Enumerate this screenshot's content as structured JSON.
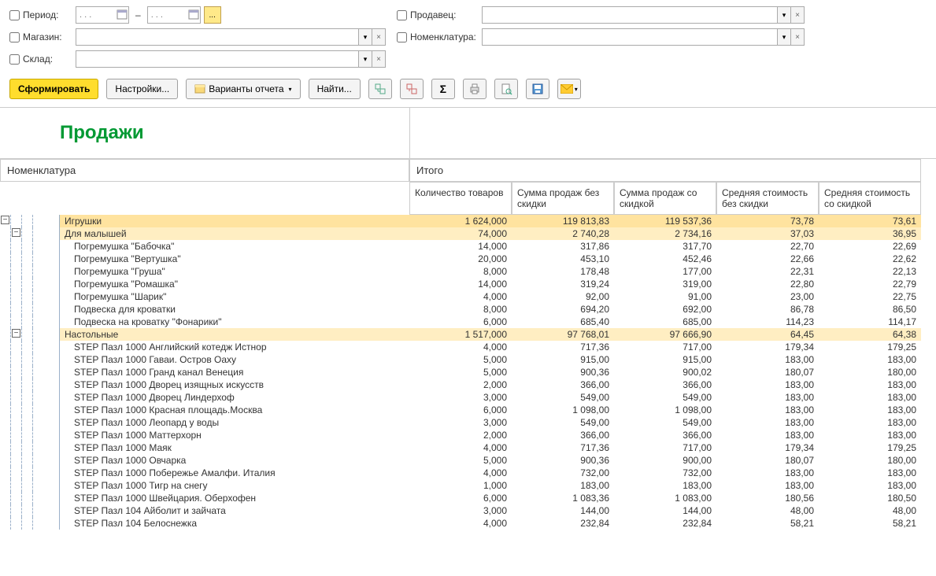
{
  "filters": {
    "period_label": "Период:",
    "date_placeholder": ". . .",
    "magazin_label": "Магазин:",
    "sklad_label": "Склад:",
    "prodavec_label": "Продавец:",
    "nomen_label": "Номенклатура:"
  },
  "toolbar": {
    "form": "Сформировать",
    "settings": "Настройки...",
    "variants": "Варианты отчета",
    "find": "Найти..."
  },
  "report": {
    "title": "Продажи",
    "header": {
      "nomen": "Номенклатура",
      "itogo": "Итого",
      "cols": [
        "Количество товаров",
        "Сумма продаж без скидки",
        "Сумма продаж со скидкой",
        "Средняя стоимость без скидки",
        "Средняя стоимость со скидкой"
      ]
    },
    "rows": [
      {
        "level": 1,
        "name": "Игрушки",
        "v": [
          "1 624,000",
          "119 813,83",
          "119 537,36",
          "73,78",
          "73,61"
        ]
      },
      {
        "level": 2,
        "name": "Для малышей",
        "v": [
          "74,000",
          "2 740,28",
          "2 734,16",
          "37,03",
          "36,95"
        ]
      },
      {
        "level": 3,
        "name": "Погремушка \"Бабочка\"",
        "v": [
          "14,000",
          "317,86",
          "317,70",
          "22,70",
          "22,69"
        ]
      },
      {
        "level": 3,
        "name": "Погремушка \"Вертушка\"",
        "v": [
          "20,000",
          "453,10",
          "452,46",
          "22,66",
          "22,62"
        ]
      },
      {
        "level": 3,
        "name": "Погремушка \"Груша\"",
        "v": [
          "8,000",
          "178,48",
          "177,00",
          "22,31",
          "22,13"
        ]
      },
      {
        "level": 3,
        "name": "Погремушка \"Ромашка\"",
        "v": [
          "14,000",
          "319,24",
          "319,00",
          "22,80",
          "22,79"
        ]
      },
      {
        "level": 3,
        "name": "Погремушка \"Шарик\"",
        "v": [
          "4,000",
          "92,00",
          "91,00",
          "23,00",
          "22,75"
        ]
      },
      {
        "level": 3,
        "name": "Подвеска для кроватки",
        "v": [
          "8,000",
          "694,20",
          "692,00",
          "86,78",
          "86,50"
        ]
      },
      {
        "level": 3,
        "name": "Подвеска на кроватку \"Фонарики\"",
        "v": [
          "6,000",
          "685,40",
          "685,00",
          "114,23",
          "114,17"
        ]
      },
      {
        "level": 2,
        "name": "Настольные",
        "v": [
          "1 517,000",
          "97 768,01",
          "97 666,90",
          "64,45",
          "64,38"
        ]
      },
      {
        "level": 3,
        "name": "STEP Пазл 1000 Английский котедж Истнор",
        "v": [
          "4,000",
          "717,36",
          "717,00",
          "179,34",
          "179,25"
        ]
      },
      {
        "level": 3,
        "name": "STEP Пазл 1000 Гаваи. Остров Оаху",
        "v": [
          "5,000",
          "915,00",
          "915,00",
          "183,00",
          "183,00"
        ]
      },
      {
        "level": 3,
        "name": "STEP Пазл 1000 Гранд канал Венеция",
        "v": [
          "5,000",
          "900,36",
          "900,02",
          "180,07",
          "180,00"
        ]
      },
      {
        "level": 3,
        "name": "STEP Пазл 1000 Дворец изящных искусств",
        "v": [
          "2,000",
          "366,00",
          "366,00",
          "183,00",
          "183,00"
        ]
      },
      {
        "level": 3,
        "name": "STEP Пазл 1000 Дворец Линдерхоф",
        "v": [
          "3,000",
          "549,00",
          "549,00",
          "183,00",
          "183,00"
        ]
      },
      {
        "level": 3,
        "name": "STEP Пазл 1000 Красная площадь.Москва",
        "v": [
          "6,000",
          "1 098,00",
          "1 098,00",
          "183,00",
          "183,00"
        ]
      },
      {
        "level": 3,
        "name": "STEP Пазл 1000 Леопард у воды",
        "v": [
          "3,000",
          "549,00",
          "549,00",
          "183,00",
          "183,00"
        ]
      },
      {
        "level": 3,
        "name": "STEP Пазл 1000 Маттерхорн",
        "v": [
          "2,000",
          "366,00",
          "366,00",
          "183,00",
          "183,00"
        ]
      },
      {
        "level": 3,
        "name": "STEP Пазл 1000 Маяк",
        "v": [
          "4,000",
          "717,36",
          "717,00",
          "179,34",
          "179,25"
        ]
      },
      {
        "level": 3,
        "name": "STEP Пазл 1000 Овчарка",
        "v": [
          "5,000",
          "900,36",
          "900,00",
          "180,07",
          "180,00"
        ]
      },
      {
        "level": 3,
        "name": "STEP Пазл 1000 Побережье Амалфи. Италия",
        "v": [
          "4,000",
          "732,00",
          "732,00",
          "183,00",
          "183,00"
        ]
      },
      {
        "level": 3,
        "name": "STEP Пазл 1000 Тигр на снегу",
        "v": [
          "1,000",
          "183,00",
          "183,00",
          "183,00",
          "183,00"
        ]
      },
      {
        "level": 3,
        "name": "STEP Пазл 1000 Швейцария. Оберхофен",
        "v": [
          "6,000",
          "1 083,36",
          "1 083,00",
          "180,56",
          "180,50"
        ]
      },
      {
        "level": 3,
        "name": "STEP Пазл 104 Айболит и зайчата",
        "v": [
          "3,000",
          "144,00",
          "144,00",
          "48,00",
          "48,00"
        ]
      },
      {
        "level": 3,
        "name": "STEP Пазл 104 Белоснежка",
        "v": [
          "4,000",
          "232,84",
          "232,84",
          "58,21",
          "58,21"
        ]
      }
    ]
  }
}
